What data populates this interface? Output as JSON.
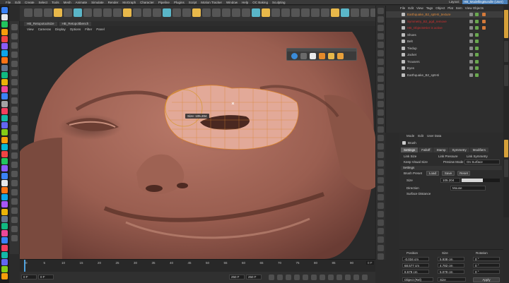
{
  "menu": [
    "File",
    "Edit",
    "Create",
    "Select",
    "Tools",
    "Mesh",
    "Animate",
    "Simulate",
    "Render",
    "MoGraph",
    "Character",
    "Pipeline",
    "Plugins",
    "Script",
    "Motion Tracker",
    "Window",
    "Help",
    "OC Baking",
    "Sculpting"
  ],
  "layout": {
    "label": "Layout:",
    "value": "HB_ModellingBundle (User)"
  },
  "viewport_tabs": [
    "HB_Retopotoolsize",
    "HB_Retopoltbench"
  ],
  "viewport_menu": [
    "View",
    "Cameras",
    "Display",
    "Options",
    "Filter",
    "Panel"
  ],
  "hud_text": "Size: 105.204",
  "objects": {
    "menu": [
      "File",
      "Edit",
      "View",
      "Tags",
      "Object",
      "Plat",
      "Item",
      "View Objects"
    ],
    "items": [
      {
        "name": "Earthquake_B2_sptHri_texture",
        "color": "#e08a3a"
      },
      {
        "name": "Symmetry_B2_pgd_remove",
        "color": "#d03030"
      },
      {
        "name": "HB_ObjectsHier is active",
        "color": "#d03030"
      },
      {
        "name": "Shoes",
        "color": "#c8c8c8"
      },
      {
        "name": "Belt",
        "color": "#c8c8c8"
      },
      {
        "name": "Tiedup",
        "color": "#c8c8c8"
      },
      {
        "name": "Jacket",
        "color": "#c8c8c8"
      },
      {
        "name": "Trousers",
        "color": "#c8c8c8"
      },
      {
        "name": "Eyes",
        "color": "#c8c8c8"
      },
      {
        "name": "Earthquake_B2_sptHri",
        "color": "#c8c8c8"
      }
    ]
  },
  "attributes": {
    "menu": [
      "Mode",
      "Edit",
      "User Data"
    ],
    "title": "Brush",
    "tabs": [
      "Settings",
      "Falloff",
      "Stamp",
      "Symmetry",
      "Modifiers"
    ],
    "active_tab": "Settings",
    "link_size": "Link Size",
    "link_pressure": "Link Pressure",
    "link_symmetry": "Link Symmetry",
    "keep_visual_size": "Keep Visual Size",
    "preview_mode_label": "Preview Mode",
    "preview_mode_value": "On Surface",
    "section": "Settings",
    "brush_preset": "Brush Preset",
    "load": "Load",
    "save": "Save",
    "reset": "Reset",
    "size_label": "Size",
    "size_value": "105.204",
    "size_fraction": 0.55,
    "direction_label": "Direction",
    "direction_value": "Mouse",
    "surface_distance": "Surface Distance"
  },
  "timeline": {
    "ticks": [
      "0",
      "5",
      "10",
      "15",
      "20",
      "25",
      "30",
      "35",
      "40",
      "45",
      "50",
      "55",
      "60",
      "65",
      "70",
      "75",
      "80",
      "85",
      "90"
    ],
    "end_frame": "0 F",
    "start_field": "0 F",
    "start_field2": "0 F",
    "end_field": "250 F",
    "end_field2": "250 F"
  },
  "coordinates": {
    "headers": [
      "Position",
      "Size",
      "Rotation"
    ],
    "rows": [
      {
        "pos": "-0.034 cm",
        "size": "5.938 cm",
        "rot": "0 °"
      },
      {
        "pos": "68.577 cm",
        "size": "4.782 cm",
        "rot": "0 °"
      },
      {
        "pos": "8.579 cm",
        "size": "5.079 cm",
        "rot": "0 °"
      }
    ],
    "mode": "Object (Rel)",
    "size_mode": "Size",
    "apply": "Apply"
  },
  "colors": {
    "accent": "#4a7fb8",
    "skin": "#a86a5a",
    "selection": "#e7b0a0",
    "wire": "#d8822e"
  }
}
